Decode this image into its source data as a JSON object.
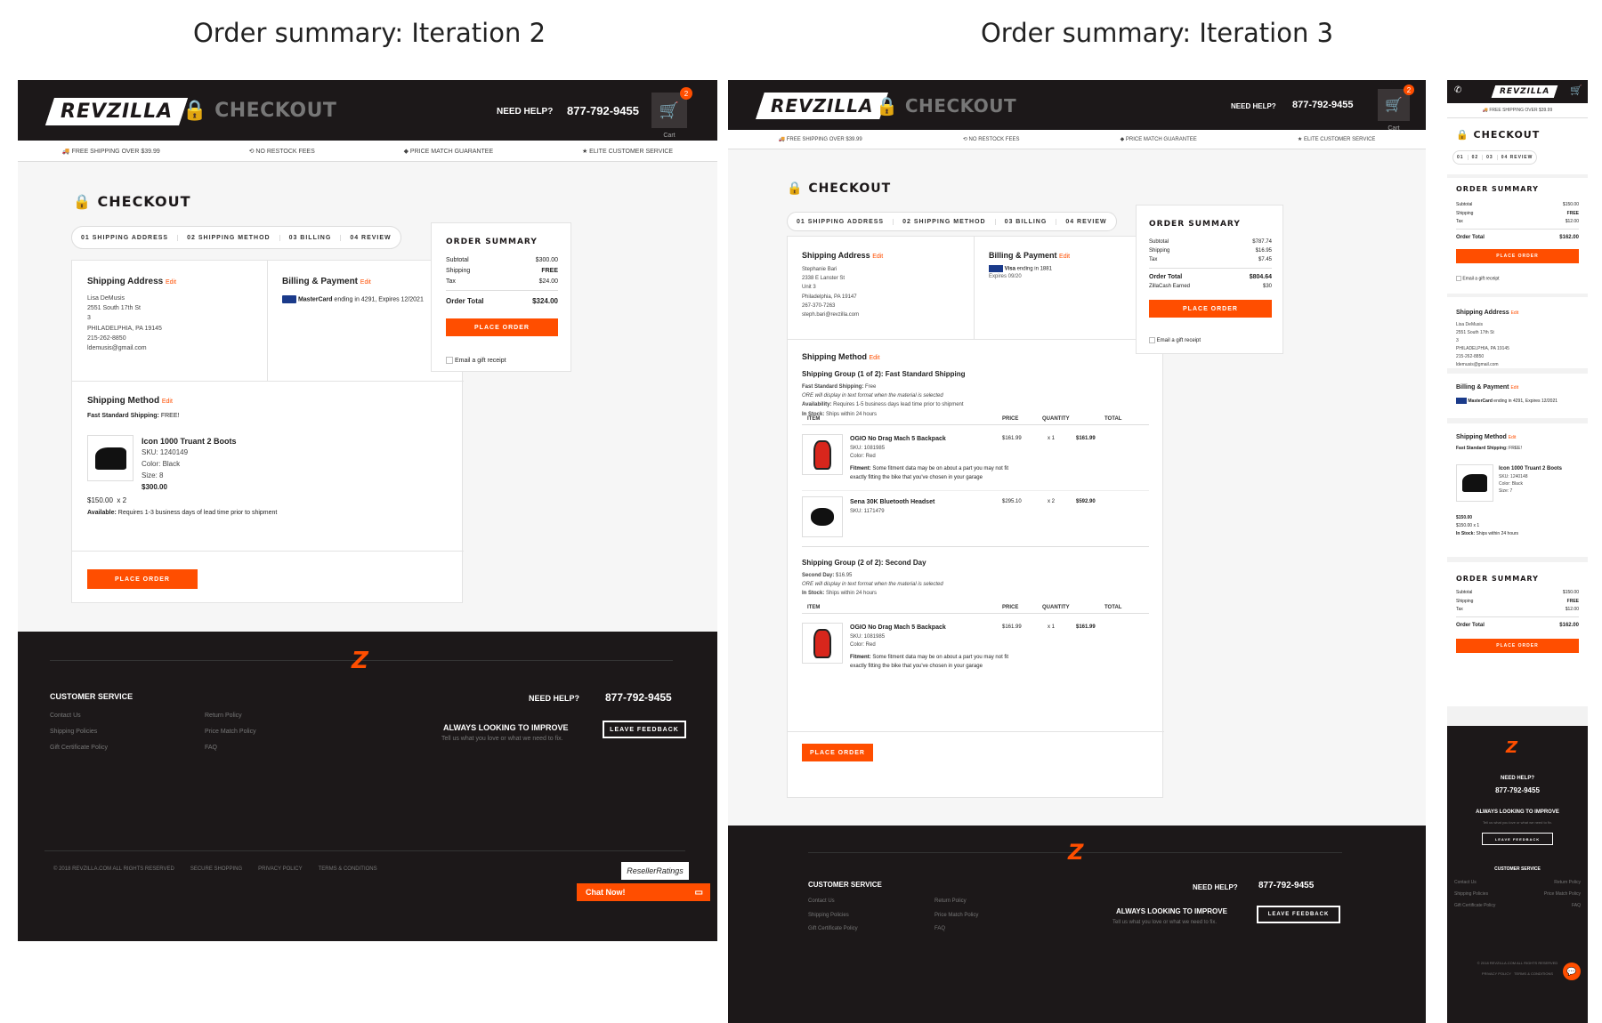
{
  "captions": {
    "left": "Order summary: Iteration 2",
    "right": "Order summary: Iteration 3"
  },
  "colors": {
    "accent": "#ff4e00",
    "dark": "#1c1819"
  },
  "brand": {
    "logo": "REVZILLA",
    "header_checkout": "CHECKOUT",
    "need_help": "NEED HELP?",
    "phone": "877-792-9455",
    "cart_label": "Cart",
    "cart_count": "2",
    "cart_count_mobile": "2"
  },
  "strip": [
    "FREE SHIPPING OVER $39.99",
    "NO RESTOCK FEES",
    "PRICE MATCH GUARANTEE",
    "ELITE CUSTOMER SERVICE"
  ],
  "checkout_title": "CHECKOUT",
  "steps": [
    "01 SHIPPING ADDRESS",
    "02 SHIPPING METHOD",
    "03 BILLING",
    "04 REVIEW"
  ],
  "mobile_steps": [
    "01",
    "02",
    "03",
    "04 REVIEW"
  ],
  "edit": "Edit",
  "it2": {
    "shipping_address": {
      "title": "Shipping Address",
      "lines": [
        "Lisa DeMusis",
        "2551 South 17th St",
        "3",
        "PHILADELPHIA, PA 19145",
        "215-262-8850",
        "ldemusis@gmail.com"
      ]
    },
    "billing": {
      "title": "Billing & Payment",
      "card": "MasterCard",
      "detail": "ending in 4291, Expires 12/2021"
    },
    "shipping_method": {
      "title": "Shipping Method",
      "label": "Fast Standard Shipping:",
      "value": "FREE!"
    },
    "product": {
      "name": "Icon 1000 Truant 2 Boots",
      "sku": "SKU: 1240149",
      "color": "Color: Black",
      "size": "Size: 8",
      "total": "$300.00",
      "unit": "$150.00",
      "qty": "x 2",
      "avail_label": "Available:",
      "avail": "Requires 1-3 business days of lead time prior to shipment"
    },
    "place_order": "PLACE ORDER",
    "summary": {
      "title": "ORDER SUMMARY",
      "subtotal_label": "Subtotal",
      "subtotal": "$300.00",
      "shipping_label": "Shipping",
      "shipping": "FREE",
      "tax_label": "Tax",
      "tax": "$24.00",
      "total_label": "Order Total",
      "total": "$324.00",
      "gift": "Email a gift receipt"
    }
  },
  "it3": {
    "shipping_address": {
      "title": "Shipping Address",
      "lines": [
        "Stephanie Bari",
        "2338 E Lanster St",
        "Unit 3",
        "Philadelphia, PA 19147",
        "267-370-7263",
        "steph.bari@revzilla.com"
      ]
    },
    "billing": {
      "title": "Billing & Payment",
      "card": "Visa",
      "detail": "ending in 1881",
      "expires": "Expires 09/20"
    },
    "shipping_method": {
      "title": "Shipping Method"
    },
    "group1": {
      "title": "Shipping Group (1 of 2): Fast Standard Shipping",
      "method_label": "Fast Standard Shipping:",
      "method_value": "Free",
      "note": "ORE will display in text format when the material is selected",
      "avail_label": "Availability:",
      "avail": "Requires 1-5 business days lead time prior to shipment",
      "stock_label": "In Stock:",
      "stock": "Ships within 24 hours"
    },
    "table_head": [
      "ITEM",
      "PRICE",
      "QUANTITY",
      "TOTAL"
    ],
    "items1": [
      {
        "name": "OGIO No Drag Mach 5 Backpack",
        "sku": "SKU: 1081985",
        "color": "Color: Red",
        "price": "$161.99",
        "qty": "x 1",
        "total": "$161.99",
        "fit_label": "Fitment:",
        "fit": "Some fitment data may be on about a part you may not fit exactly fitting the bike that you've chosen in your garage"
      },
      {
        "name": "Sena 30K Bluetooth Headset",
        "sku": "SKU: 1171479",
        "price": "$295.10",
        "qty": "x 2",
        "total": "$592.90"
      }
    ],
    "group2": {
      "title": "Shipping Group (2 of 2): Second Day",
      "method_label": "Second Day:",
      "method_value": "$16.95",
      "note": "ORE will display in text format when the material is selected",
      "stock_label": "In Stock:",
      "stock": "Ships within 24 hours"
    },
    "items2": [
      {
        "name": "OGIO No Drag Mach 5 Backpack",
        "sku": "SKU: 1081985",
        "color": "Color: Red",
        "price": "$161.99",
        "qty": "x 1",
        "total": "$161.99",
        "fit_label": "Fitment:",
        "fit": "Some fitment data may be on about a part you may not fit exactly fitting the bike that you've chosen in your garage"
      }
    ],
    "place_order": "PLACE ORDER",
    "summary": {
      "title": "ORDER SUMMARY",
      "subtotal_label": "Subtotal",
      "subtotal": "$787.74",
      "shipping_label": "Shipping",
      "shipping": "$16.95",
      "tax_label": "Tax",
      "tax": "$7.45",
      "total_label": "Order Total",
      "total": "$804.64",
      "zilla_label": "ZillaCash Earned",
      "zilla": "$30",
      "gift": "Email a gift receipt"
    }
  },
  "mobile": {
    "summary": {
      "title": "ORDER SUMMARY",
      "subtotal_label": "Subtotal",
      "subtotal": "$150.00",
      "shipping_label": "Shipping",
      "shipping": "FREE",
      "tax_label": "Tax",
      "tax": "$12.00",
      "total_label": "Order Total",
      "total": "$162.00",
      "gift": "Email a gift receipt"
    },
    "shipping_address": {
      "title": "Shipping Address",
      "lines": [
        "Lisa DeMusis",
        "2551 South 17th St",
        "3",
        "PHILADELPHIA, PA 19145",
        "215-262-8850",
        "ldemusis@gmail.com"
      ]
    },
    "billing": {
      "title": "Billing & Payment",
      "card": "MasterCard",
      "detail": "ending in 4291, Expires 12/2021"
    },
    "shipping_method": {
      "title": "Shipping Method",
      "label": "Fast Standard Shipping:",
      "value": "FREE!"
    },
    "product": {
      "name": "Icon 1000 Truant 2 Boots",
      "sku": "SKU: 1240148",
      "color": "Color: Black",
      "size": "Size: 7",
      "price": "$150.00",
      "unit": "$150.00",
      "qty": "x 1",
      "stock_label": "In Stock:",
      "stock": "Ships within 24 hours"
    },
    "place_order": "PLACE ORDER",
    "footer_need_help": "NEED HELP?",
    "footer_phone": "877-792-9455",
    "copyright": "© 2018 REVZILLA.COM ALL RIGHTS RESERVED",
    "privacy": "PRIVACY POLICY",
    "terms": "TERMS & CONDITIONS"
  },
  "footer": {
    "customer_service": "CUSTOMER SERVICE",
    "links_left": [
      "Contact Us",
      "Shipping Policies",
      "Gift Certificate Policy"
    ],
    "links_right": [
      "Return Policy",
      "Price Match Policy",
      "FAQ"
    ],
    "need_help": "NEED HELP?",
    "phone": "877-792-9455",
    "improve": "ALWAYS LOOKING TO IMPROVE",
    "improve_sub": "Tell us what you love or what we need to fix.",
    "leave_feedback": "LEAVE FEEDBACK",
    "legal": [
      "© 2018 REVZILLA.COM ALL RIGHTS RESERVED",
      "SECURE SHOPPING",
      "PRIVACY POLICY",
      "TERMS & CONDITIONS"
    ],
    "reseller": "ResellerRatings",
    "chat": "Chat Now!"
  }
}
